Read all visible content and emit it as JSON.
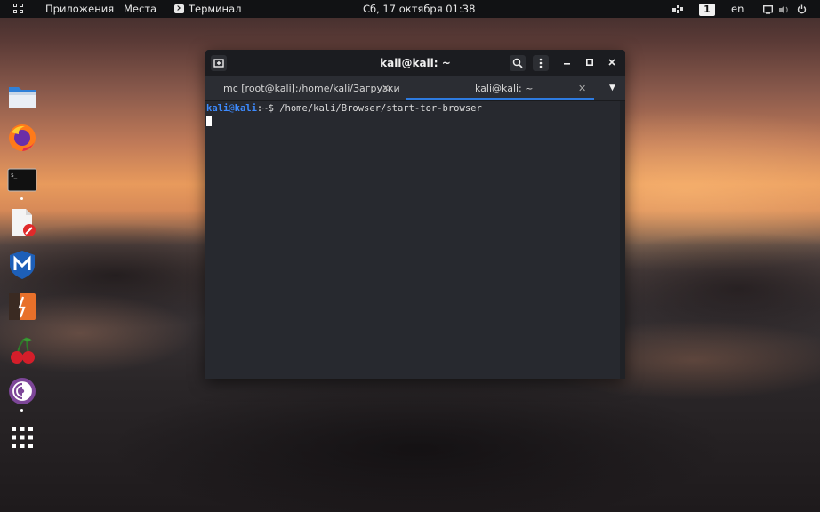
{
  "topbar": {
    "applications": "Приложения",
    "places": "Места",
    "active_app": "Терминал",
    "clock": "Сб, 17 октября  01:38",
    "workspace": "1",
    "keyboard_layout": "en"
  },
  "dock": {
    "apps": [
      {
        "icon": "file-manager-icon",
        "running": false
      },
      {
        "icon": "firefox-icon",
        "running": false
      },
      {
        "icon": "terminal-icon",
        "running": true
      },
      {
        "icon": "text-editor-icon",
        "running": false
      },
      {
        "icon": "metasploit-icon",
        "running": false
      },
      {
        "icon": "burpsuite-icon",
        "running": false
      },
      {
        "icon": "cherrytree-icon",
        "running": false
      },
      {
        "icon": "tor-browser-icon",
        "running": true
      },
      {
        "icon": "show-apps-icon",
        "running": false
      }
    ]
  },
  "terminal": {
    "title": "kali@kali: ~",
    "tabs": [
      {
        "label": "mc [root@kali]:/home/kali/Загрузки",
        "active": false
      },
      {
        "label": "kali@kali: ~",
        "active": true
      }
    ],
    "prompt_user": "kali",
    "prompt_at": "@",
    "prompt_host": "kali",
    "prompt_path": ":~$ ",
    "command": "/home/kali/Browser/start-tor-browser"
  },
  "colors": {
    "accent": "#2e7be0",
    "prompt": "#3d8bff",
    "terminal_bg": "#27292f",
    "topbar_bg": "#111214"
  }
}
